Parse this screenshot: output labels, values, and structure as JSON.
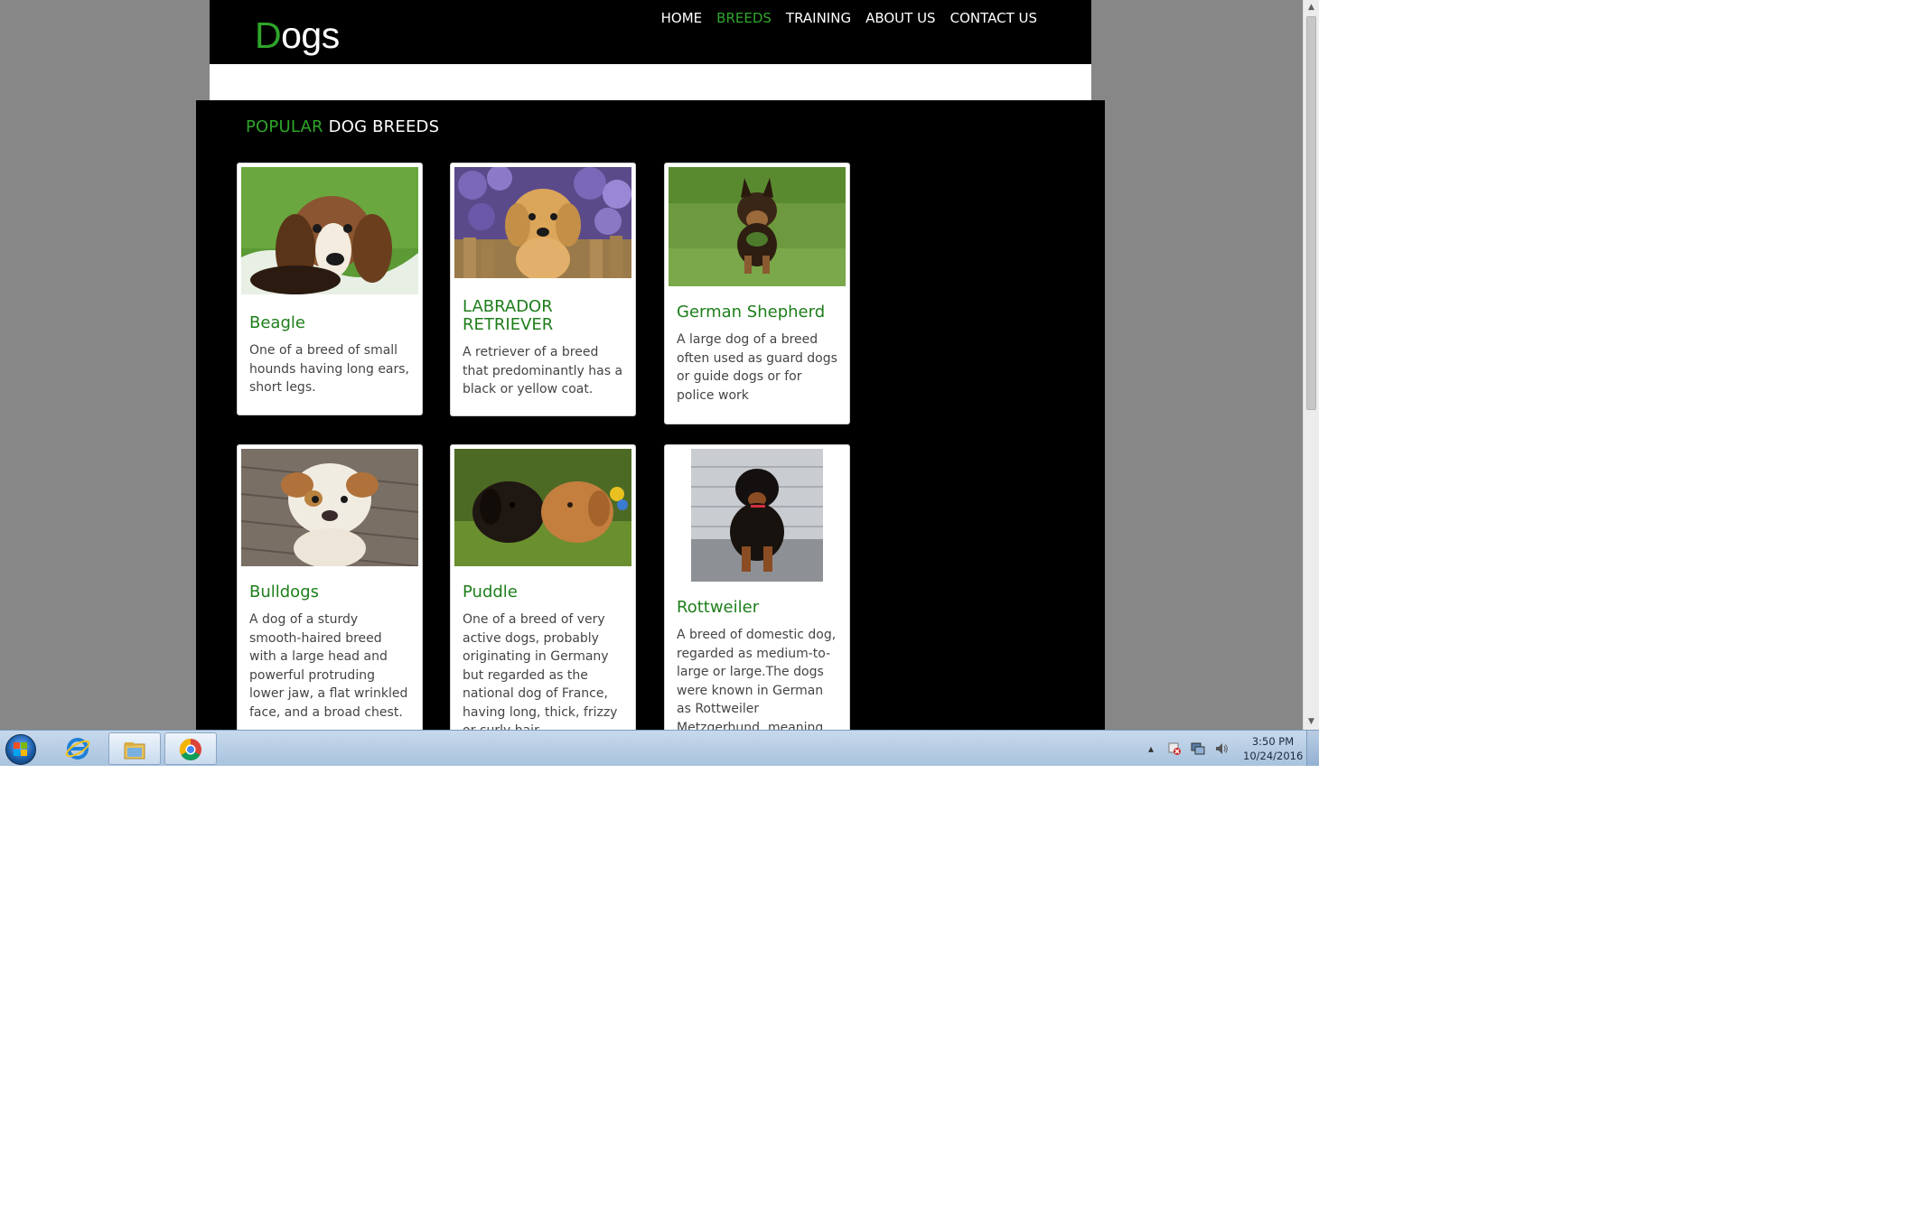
{
  "site": {
    "logo_first": "D",
    "logo_rest": "ogs",
    "nav": [
      {
        "label": "HOME"
      },
      {
        "label": "BREEDS"
      },
      {
        "label": "TRAINING"
      },
      {
        "label": "ABOUT US"
      },
      {
        "label": "CONTACT US"
      }
    ],
    "active_nav": "BREEDS",
    "accent": "#2fa52a"
  },
  "section": {
    "title_highlight": "POPULAR",
    "title_rest": "DOG BREEDS"
  },
  "cards": [
    {
      "title": "Beagle",
      "desc": "One of a breed of small hounds having long ears, short legs.",
      "image": "beagle-photo"
    },
    {
      "title": "LABRADOR RETRIEVER",
      "desc": "A retriever of a breed that predominantly has a black or yellow coat.",
      "image": "labrador-photo"
    },
    {
      "title": "German Shepherd",
      "desc": "A large dog of a breed often used as guard dogs or guide dogs or for police work",
      "image": "german-shepherd-photo"
    },
    {
      "title": "Bulldogs",
      "desc": "A dog of a sturdy smooth-haired breed with a large head and powerful protruding lower jaw, a flat wrinkled face, and a broad chest.",
      "image": "bulldog-photo"
    },
    {
      "title": "Puddle",
      "desc": "One of a breed of very active dogs, probably originating in Germany but regarded as the national dog of France, having long, thick, frizzy or curly hair.",
      "image": "puddle-photo"
    },
    {
      "title": "Rottweiler",
      "desc": "A breed of domestic dog, regarded as medium-to-large or large.The dogs were known in German as Rottweiler Metzgerhund, meaning Rottweil butchers'",
      "image": "rottweiler-photo"
    }
  ],
  "taskbar": {
    "time": "3:50 PM",
    "date": "10/24/2016",
    "icons": [
      "start-orb-icon",
      "internet-explorer-icon",
      "file-explorer-icon",
      "chrome-icon"
    ],
    "tray_icons": [
      "show-hidden-icons-icon",
      "action-center-icon",
      "network-icon",
      "volume-icon"
    ]
  }
}
